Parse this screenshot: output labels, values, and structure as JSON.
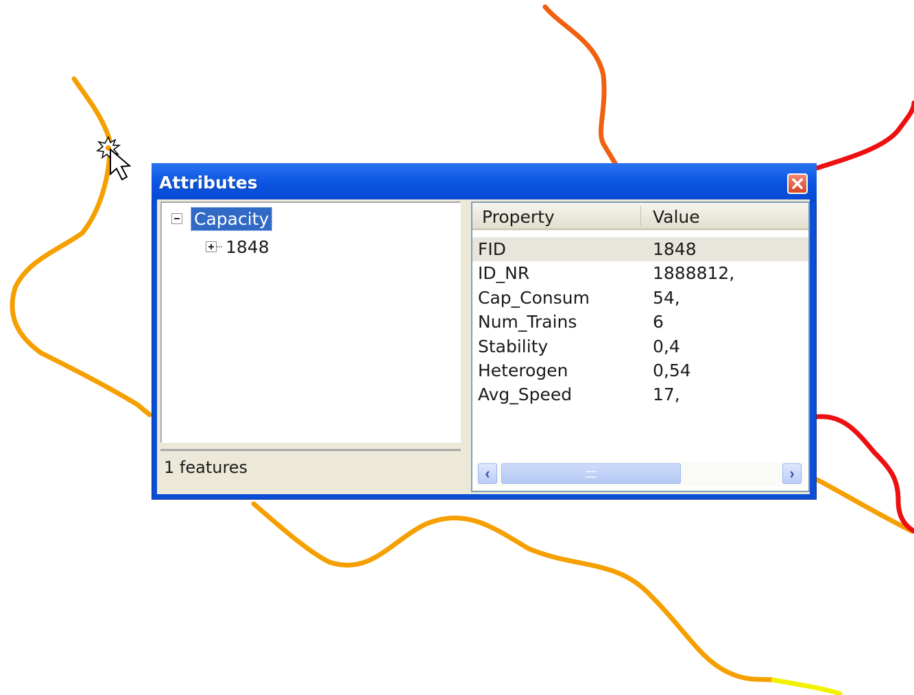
{
  "window": {
    "title": "Attributes"
  },
  "tree": {
    "root_label": "Capacity",
    "child_label": "1848"
  },
  "status": {
    "text": "1 features"
  },
  "grid": {
    "columns": [
      "Property",
      "Value"
    ],
    "rows": [
      {
        "property": "FID",
        "value": "1848"
      },
      {
        "property": "ID_NR",
        "value": "1888812,"
      },
      {
        "property": "Cap_Consum",
        "value": "54,"
      },
      {
        "property": "Num_Trains",
        "value": "6"
      },
      {
        "property": "Stability",
        "value": "0,4"
      },
      {
        "property": "Heterogen",
        "value": "0,54"
      },
      {
        "property": "Avg_Speed",
        "value": "17,"
      }
    ],
    "selected_row": 0
  },
  "icons": {
    "close": "close-icon",
    "scroll_left": "chevron-left-icon",
    "scroll_right": "chevron-right-icon",
    "cursor": "identify-cursor-icon"
  },
  "colors": {
    "titlebar": "#0a54e0",
    "selection": "#316ac5",
    "route_orange": "#f5a000",
    "route_dark_orange": "#f06010",
    "route_red": "#ee1010",
    "route_yellow": "#f2f200"
  }
}
